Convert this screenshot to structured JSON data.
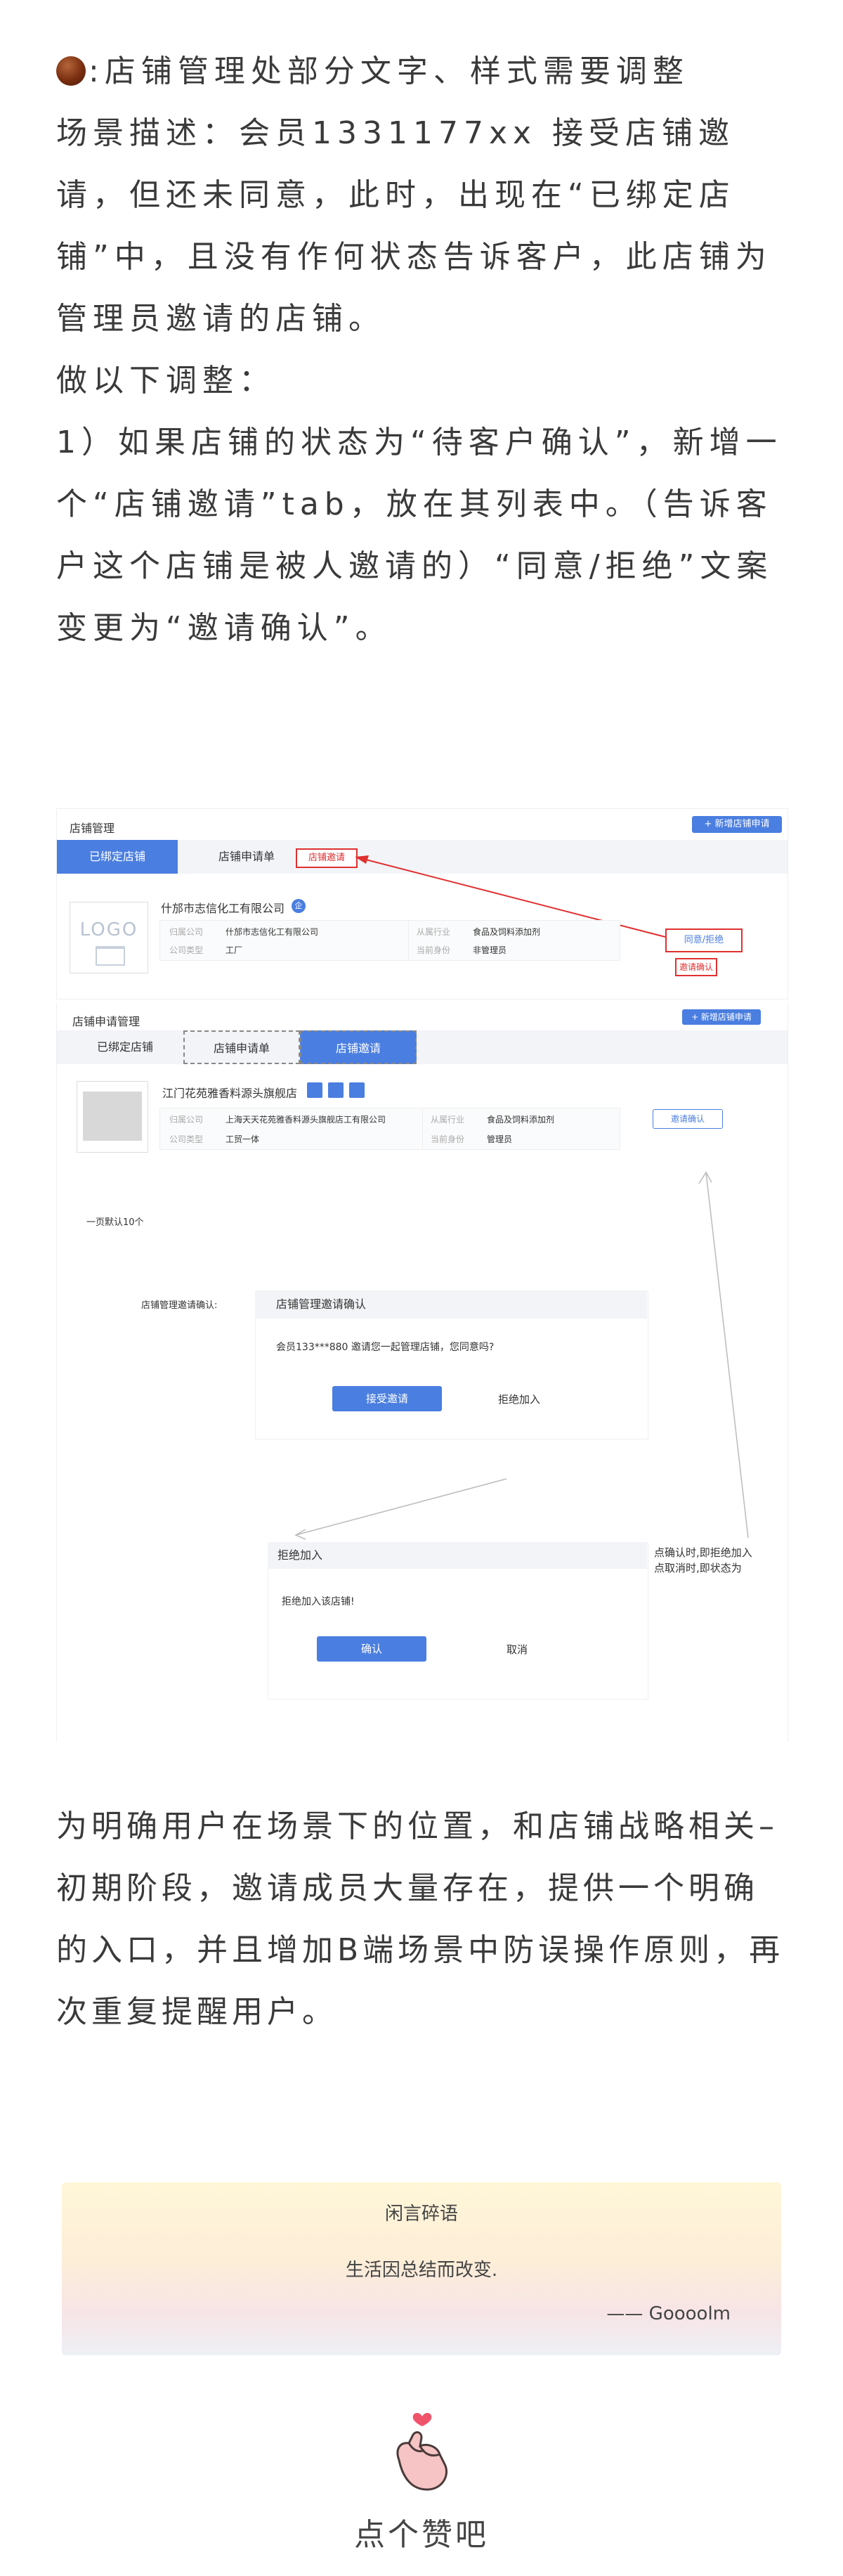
{
  "intro": {
    "heading_suffix": ":店铺管理处部分文字、样式需要调整",
    "scene": "场景描述：会员1331177xx 接受店铺邀请，但还未同意，此时，出现在“已绑定店铺”中，且没有作何状态告诉客户，此店铺为管理员邀请的店铺。",
    "adjust": "做以下调整：",
    "item1": "1）如果店铺的状态为“待客户确认”，新增一个“店铺邀请”tab，放在其列表中。（告诉客户这个店铺是被人邀请的）“同意/拒绝”文案变更为“邀请确认”。"
  },
  "shot1": {
    "page_title": "店铺管理",
    "new_button": "+ 新增店铺申请",
    "tab_bound": "已绑定店铺",
    "tab_apply": "店铺申请单",
    "tab_invite_note": "店铺邀请",
    "logo_text": "LOGO",
    "company_name": "什邡市志信化工有限公司",
    "verified_badge": "企",
    "label_company": "归属公司",
    "value_company": "什邡市志信化工有限公司",
    "label_type": "公司类型",
    "value_type": "工厂",
    "label_industry": "从属行业",
    "value_industry": "食品及饲料添加剂",
    "label_role": "当前身份",
    "value_role": "非管理员",
    "agree_reject": "同意/拒绝",
    "invite_confirm": "邀请确认"
  },
  "shot2": {
    "page_title": "店铺申请管理",
    "new_button": "+ 新增店铺申请",
    "tab_bound": "已绑定店铺",
    "tab_apply": "店铺申请单",
    "tab_invite": "店铺邀请",
    "shop_name": "江门花苑雅香料源头旗舰店",
    "label_company": "归属公司",
    "value_company": "上海天天花苑雅香料源头旗舰店工有限公司",
    "label_type": "公司类型",
    "value_type": "工贸一体",
    "label_industry": "从属行业",
    "value_industry": "食品及饲料添加剂",
    "label_role": "当前身份",
    "value_role": "管理员",
    "invite_confirm_btn": "邀请确认",
    "page_size_note": "一页默认10个",
    "dialog_label": "店铺管理邀请确认:",
    "dialog_title": "店铺管理邀请确认",
    "dialog_msg": "会员133***880 邀请您一起管理店铺，您同意吗?",
    "accept_btn": "接受邀请",
    "reject_link": "拒绝加入",
    "reject_title": "拒绝加入",
    "reject_msg": "拒绝加入该店铺!",
    "confirm_btn": "确认",
    "cancel_link": "取消",
    "side_note_1": "点确认时,即拒绝加入",
    "side_note_2": "点取消时,即状态为"
  },
  "para2": "为明确用户在场景下的位置，和店铺战略相关–初期阶段，邀请成员大量存在，提供一个明确的入口，并且增加B端场景中防误操作原则，再次重复提醒用户。",
  "quote": {
    "title": "闲言碎语",
    "text": "生活因总结而改变.",
    "author": "—— Goooolm"
  },
  "like": {
    "label": "点个赞吧"
  },
  "colors": {
    "accent_blue": "#4a7ee0",
    "annotation_red": "#e03030"
  }
}
